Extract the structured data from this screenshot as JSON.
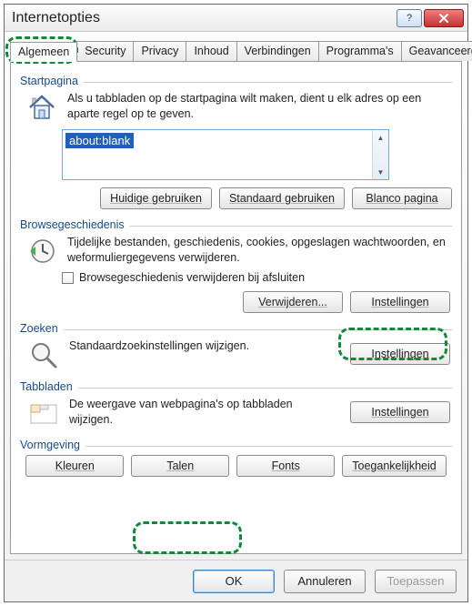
{
  "window": {
    "title": "Internetopties"
  },
  "tabs": [
    "Algemeen",
    "Security",
    "Privacy",
    "Inhoud",
    "Verbindingen",
    "Programma's",
    "Geavanceerd"
  ],
  "startpagina": {
    "legend": "Startpagina",
    "desc": "Als u tabbladen op de startpagina wilt maken, dient u elk adres op een aparte regel op te geven.",
    "value": "about:blank",
    "btn_current": "Huidige gebruiken",
    "btn_default": "Standaard gebruiken",
    "btn_blank": "Blanco pagina"
  },
  "history": {
    "legend": "Browsegeschiedenis",
    "desc": "Tijdelijke bestanden, geschiedenis, cookies, opgeslagen wachtwoorden, en weformuliergegevens verwijderen.",
    "checkbox": "Browsegeschiedenis verwijderen bij afsluiten",
    "btn_delete": "Verwijderen...",
    "btn_settings": "Instellingen"
  },
  "search": {
    "legend": "Zoeken",
    "desc": "Standaardzoekinstellingen wijzigen.",
    "btn_settings": "Instellingen"
  },
  "tabsgroup": {
    "legend": "Tabbladen",
    "desc": "De weergave van webpagina's op tabbladen wijzigen.",
    "btn_settings": "Instellingen"
  },
  "appearance": {
    "legend": "Vormgeving",
    "btn_colors": "Kleuren",
    "btn_languages": "Talen",
    "btn_fonts": "Fonts",
    "btn_accessibility": "Toegankelijkheid"
  },
  "bottom": {
    "ok": "OK",
    "cancel": "Annuleren",
    "apply": "Toepassen"
  }
}
